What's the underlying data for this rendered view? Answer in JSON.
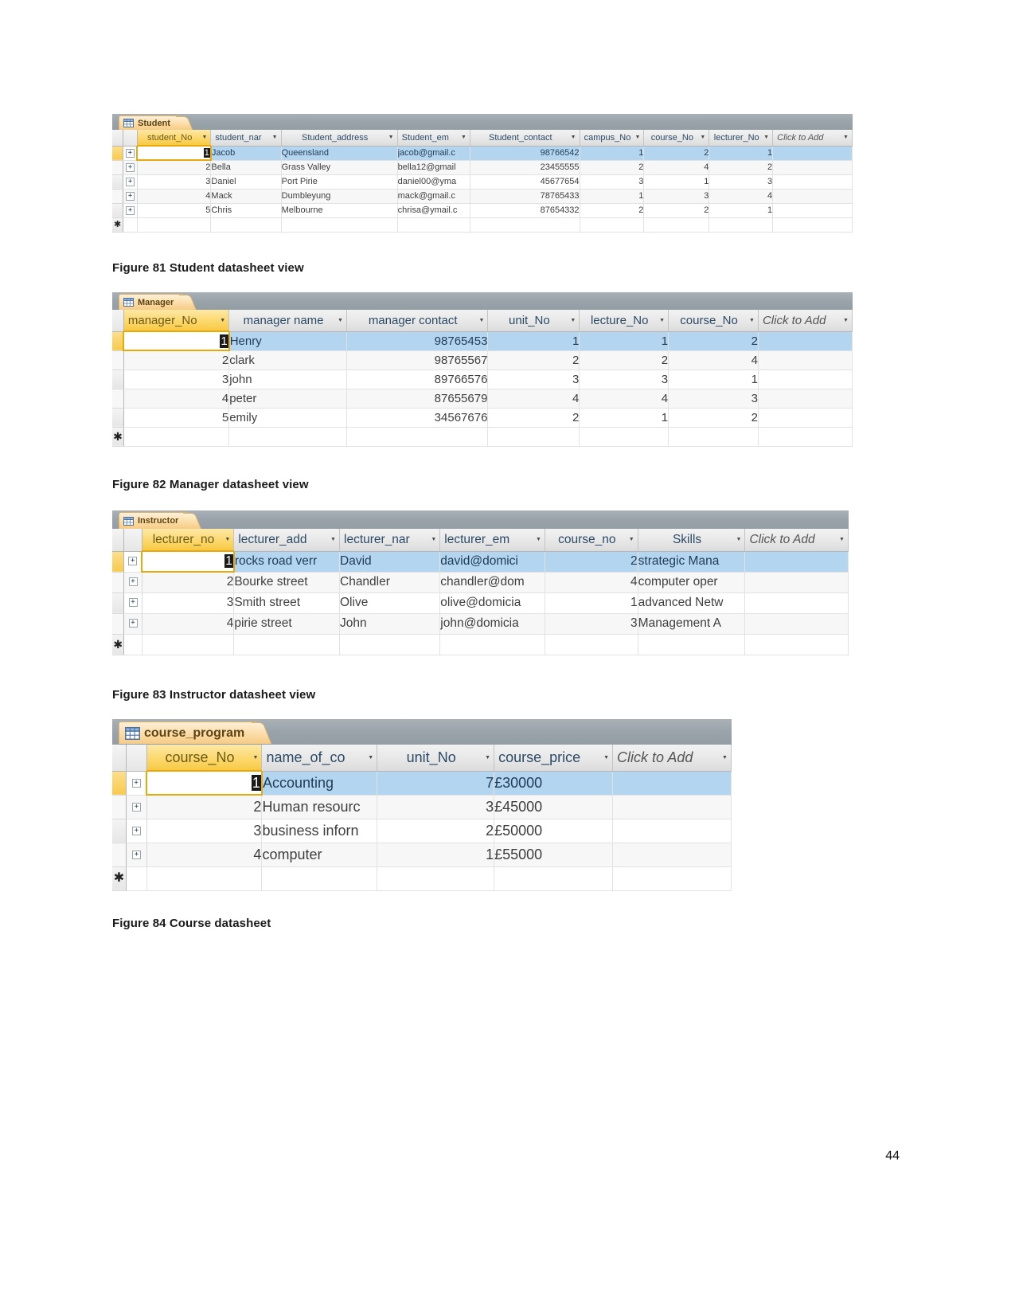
{
  "page": {
    "number": "44"
  },
  "figures": [
    {
      "caption": "Figure 81 Student datasheet view",
      "tab_label": "Student",
      "add_column_label": "Click to Add",
      "columns": [
        {
          "name": "student_No",
          "pk": true,
          "align": "center"
        },
        {
          "name": "student_nar",
          "pk": false,
          "align": "left"
        },
        {
          "name": "Student_address",
          "pk": false,
          "align": "center"
        },
        {
          "name": "Student_em",
          "pk": false,
          "align": "left"
        },
        {
          "name": "Student_contact",
          "pk": false,
          "align": "center"
        },
        {
          "name": "campus_No",
          "pk": false,
          "align": "center"
        },
        {
          "name": "course_No",
          "pk": false,
          "align": "center"
        },
        {
          "name": "lecturer_No",
          "pk": false,
          "align": "center"
        }
      ],
      "rows": [
        {
          "selected": true,
          "editing": true,
          "cells": [
            "1",
            "Jacob",
            "Queensland",
            "jacob@gmail.c",
            "98766542",
            "1",
            "2",
            "1"
          ]
        },
        {
          "selected": false,
          "editing": false,
          "cells": [
            "2",
            "Bella",
            "Grass Valley",
            "bella12@gmail",
            "23455555",
            "2",
            "4",
            "2"
          ]
        },
        {
          "selected": false,
          "editing": false,
          "cells": [
            "3",
            "Daniel",
            "Port Pirie",
            "daniel00@yma",
            "45677654",
            "3",
            "1",
            "3"
          ]
        },
        {
          "selected": false,
          "editing": false,
          "cells": [
            "4",
            "Mack",
            "Dumbleyung",
            "mack@gmail.c",
            "78765433",
            "1",
            "3",
            "4"
          ]
        },
        {
          "selected": false,
          "editing": false,
          "cells": [
            "5",
            "Chris",
            "Melbourne",
            "chrisa@ymail.c",
            "87654332",
            "2",
            "2",
            "1"
          ]
        }
      ],
      "new_record_marker": "✱"
    },
    {
      "caption": "Figure 82 Manager datasheet view",
      "tab_label": "Manager",
      "add_column_label": "Click to Add",
      "columns": [
        {
          "name": "manager_No",
          "pk": true,
          "align": "left"
        },
        {
          "name": "manager name",
          "pk": false,
          "align": "center"
        },
        {
          "name": "manager contact",
          "pk": false,
          "align": "center"
        },
        {
          "name": "unit_No",
          "pk": false,
          "align": "center"
        },
        {
          "name": "lecture_No",
          "pk": false,
          "align": "center"
        },
        {
          "name": "course_No",
          "pk": false,
          "align": "center"
        }
      ],
      "rows": [
        {
          "selected": true,
          "editing": true,
          "cells": [
            "1",
            "Henry",
            "98765453",
            "1",
            "1",
            "2"
          ]
        },
        {
          "selected": false,
          "editing": false,
          "cells": [
            "2",
            "clark",
            "98765567",
            "2",
            "2",
            "4"
          ]
        },
        {
          "selected": false,
          "editing": false,
          "cells": [
            "3",
            "john",
            "89766576",
            "3",
            "3",
            "1"
          ]
        },
        {
          "selected": false,
          "editing": false,
          "cells": [
            "4",
            "peter",
            "87655679",
            "4",
            "4",
            "3"
          ]
        },
        {
          "selected": false,
          "editing": false,
          "cells": [
            "5",
            "emily",
            "34567676",
            "2",
            "1",
            "2"
          ]
        }
      ],
      "new_record_marker": "✱"
    },
    {
      "caption": "Figure 83 Instructor datasheet view",
      "tab_label": "Instructor",
      "add_column_label": "Click to Add",
      "columns": [
        {
          "name": "lecturer_no",
          "pk": true,
          "align": "center"
        },
        {
          "name": "lecturer_add",
          "pk": false,
          "align": "left"
        },
        {
          "name": "lecturer_nar",
          "pk": false,
          "align": "left"
        },
        {
          "name": "lecturer_em",
          "pk": false,
          "align": "left"
        },
        {
          "name": "course_no",
          "pk": false,
          "align": "center"
        },
        {
          "name": "Skills",
          "pk": false,
          "align": "center"
        }
      ],
      "rows": [
        {
          "selected": true,
          "editing": true,
          "cells": [
            "1",
            "rocks road verr",
            "David",
            "david@domici",
            "2",
            "strategic Mana"
          ]
        },
        {
          "selected": false,
          "editing": false,
          "cells": [
            "2",
            "Bourke street",
            "Chandler",
            "chandler@dom",
            "4",
            "computer oper"
          ]
        },
        {
          "selected": false,
          "editing": false,
          "cells": [
            "3",
            "Smith street",
            "Olive",
            "olive@domicia",
            "1",
            "advanced Netw"
          ]
        },
        {
          "selected": false,
          "editing": false,
          "cells": [
            "4",
            "pirie street",
            "John",
            "john@domicia",
            "3",
            "Management A"
          ]
        }
      ],
      "new_record_marker": "✱"
    },
    {
      "caption": "Figure 84 Course datasheet",
      "tab_label": "course_program",
      "add_column_label": "Click to Add",
      "columns": [
        {
          "name": "course_No",
          "pk": true,
          "align": "center"
        },
        {
          "name": "name_of_co",
          "pk": false,
          "align": "left"
        },
        {
          "name": "unit_No",
          "pk": false,
          "align": "center"
        },
        {
          "name": "course_price",
          "pk": false,
          "align": "left"
        }
      ],
      "rows": [
        {
          "selected": true,
          "editing": true,
          "cells": [
            "1",
            "Accounting",
            "7",
            "£30000"
          ]
        },
        {
          "selected": false,
          "editing": false,
          "cells": [
            "2",
            "Human resourc",
            "3",
            "£45000"
          ]
        },
        {
          "selected": false,
          "editing": false,
          "cells": [
            "3",
            "business inforn",
            "2",
            "£50000"
          ]
        },
        {
          "selected": false,
          "editing": false,
          "cells": [
            "4",
            "computer",
            "1",
            "£55000"
          ]
        }
      ],
      "new_record_marker": "✱"
    }
  ],
  "colors": {
    "primary_key_header": "#f8c944",
    "selected_row": "#b4d5f0",
    "tab_accent": "#f6cb86",
    "tabbar": "#9aa3aa",
    "editing_border": "#e9a90a"
  }
}
